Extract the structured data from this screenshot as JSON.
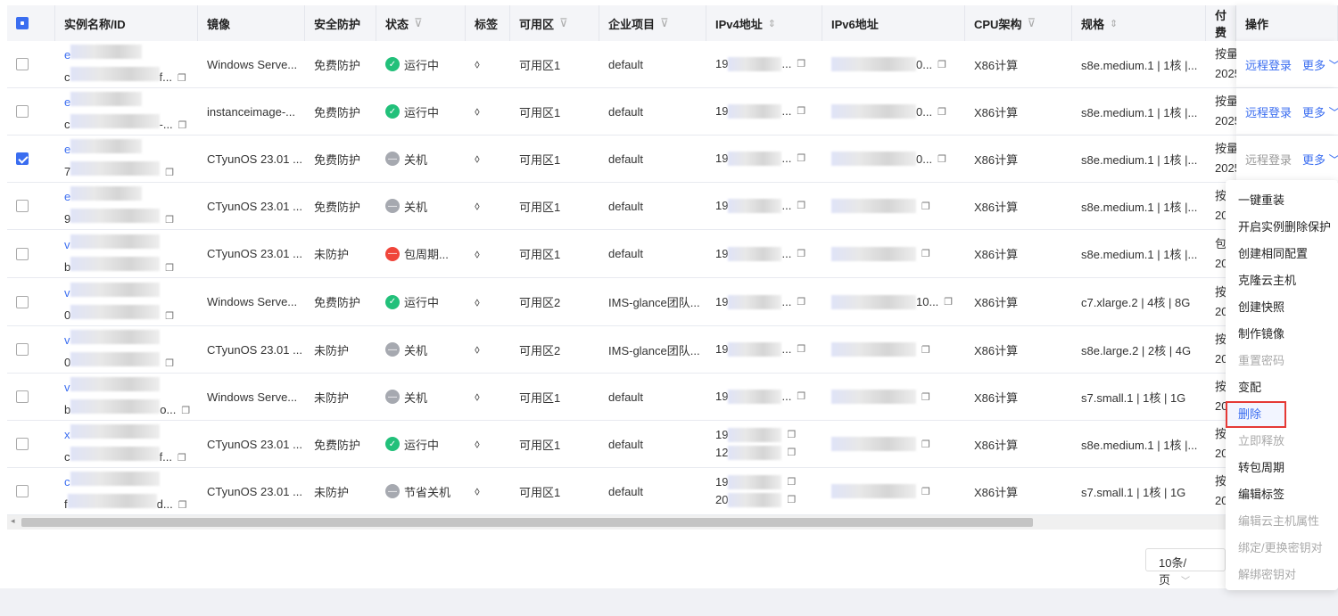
{
  "columns": [
    "实例名称/ID",
    "镜像",
    "安全防护",
    "状态",
    "标签",
    "可用区",
    "企业项目",
    "IPv4地址",
    "IPv6地址",
    "CPU架构",
    "规格",
    "付费",
    "操作"
  ],
  "rows": [
    {
      "checked": false,
      "name": "e",
      "id": "c",
      "idtail": "f...",
      "image": "Windows Serve...",
      "security": "免费防护",
      "status": "运行中",
      "st": "run",
      "zone": "可用区1",
      "project": "default",
      "ipv4": [
        "19"
      ],
      "ipv6": "0...",
      "cpu": "X86计算",
      "spec": "s8e.medium.1 | 1核 |...",
      "pay": [
        "按量",
        "2025"
      ],
      "login_disabled": false
    },
    {
      "checked": false,
      "name": "e",
      "id": "c",
      "idtail": "-...",
      "image": "instanceimage-...",
      "security": "免费防护",
      "status": "运行中",
      "st": "run",
      "zone": "可用区1",
      "project": "default",
      "ipv4": [
        "19"
      ],
      "ipv6": "0...",
      "cpu": "X86计算",
      "spec": "s8e.medium.1 | 1核 |...",
      "pay": [
        "按量",
        "2025"
      ],
      "login_disabled": false
    },
    {
      "checked": true,
      "name": "e",
      "id": "7",
      "idtail": "",
      "image": "CTyunOS 23.01 ...",
      "security": "免费防护",
      "status": "关机",
      "st": "off",
      "zone": "可用区1",
      "project": "default",
      "ipv4": [
        "19"
      ],
      "ipv6": "0...",
      "cpu": "X86计算",
      "spec": "s8e.medium.1 | 1核 |...",
      "pay": [
        "按量",
        "2025"
      ],
      "login_disabled": true
    },
    {
      "checked": false,
      "name": "e",
      "id": "9",
      "idtail": "",
      "image": "CTyunOS 23.01 ...",
      "security": "免费防护",
      "status": "关机",
      "st": "off",
      "zone": "可用区1",
      "project": "default",
      "ipv4": [
        "19"
      ],
      "ipv6": "",
      "cpu": "X86计算",
      "spec": "s8e.medium.1 | 1核 |...",
      "pay": [
        "按",
        "20"
      ]
    },
    {
      "checked": false,
      "name": "v",
      "id": "b",
      "idtail": "",
      "image": "CTyunOS 23.01 ...",
      "security": "未防护",
      "status": "包周期...",
      "st": "err",
      "zone": "可用区1",
      "project": "default",
      "ipv4": [
        "19"
      ],
      "ipv6": "",
      "cpu": "X86计算",
      "spec": "s8e.medium.1 | 1核 |...",
      "pay": [
        "包",
        "20"
      ]
    },
    {
      "checked": false,
      "name": "v",
      "id": "0",
      "idtail": "",
      "image": "Windows Serve...",
      "security": "免费防护",
      "status": "运行中",
      "st": "run",
      "zone": "可用区2",
      "project": "IMS-glance团队...",
      "ipv4": [
        "19"
      ],
      "ipv6": "10...",
      "cpu": "X86计算",
      "spec": "c7.xlarge.2 | 4核 | 8G",
      "pay": [
        "按",
        "20"
      ]
    },
    {
      "checked": false,
      "name": "v",
      "id": "0",
      "idtail": "",
      "image": "CTyunOS 23.01 ...",
      "security": "未防护",
      "status": "关机",
      "st": "off",
      "zone": "可用区2",
      "project": "IMS-glance团队...",
      "ipv4": [
        "19"
      ],
      "ipv6": "",
      "cpu": "X86计算",
      "spec": "s8e.large.2 | 2核 | 4G",
      "pay": [
        "按",
        "20"
      ]
    },
    {
      "checked": false,
      "name": "v",
      "id": "b",
      "idtail": "o...",
      "image": "Windows Serve...",
      "security": "未防护",
      "status": "关机",
      "st": "off",
      "zone": "可用区1",
      "project": "default",
      "ipv4": [
        "19"
      ],
      "ipv6": "",
      "cpu": "X86计算",
      "spec": "s7.small.1 | 1核 | 1G",
      "pay": [
        "按",
        "20"
      ]
    },
    {
      "checked": false,
      "name": "x",
      "id": "c",
      "idtail": "f...",
      "image": "CTyunOS 23.01 ...",
      "security": "免费防护",
      "status": "运行中",
      "st": "run",
      "zone": "可用区1",
      "project": "default",
      "ipv4": [
        "19",
        "12"
      ],
      "ipv6": "",
      "cpu": "X86计算",
      "spec": "s8e.medium.1 | 1核 |...",
      "pay": [
        "按",
        "20"
      ]
    },
    {
      "checked": false,
      "name": "c",
      "id": "f",
      "idtail": "d...",
      "image": "CTyunOS 23.01 ...",
      "security": "未防护",
      "status": "节省关机",
      "st": "off",
      "zone": "可用区1",
      "project": "default",
      "ipv4": [
        "19",
        "20"
      ],
      "ipv6": "",
      "cpu": "X86计算",
      "spec": "s7.small.1 | 1核 | 1G",
      "pay": [
        "按",
        "20"
      ]
    }
  ],
  "ops": {
    "login": "远程登录",
    "more": "更多"
  },
  "menu": [
    {
      "label": "一键重装",
      "state": "normal"
    },
    {
      "label": "开启实例删除保护",
      "state": "normal"
    },
    {
      "label": "创建相同配置",
      "state": "normal"
    },
    {
      "label": "克隆云主机",
      "state": "normal"
    },
    {
      "label": "创建快照",
      "state": "normal"
    },
    {
      "label": "制作镜像",
      "state": "normal"
    },
    {
      "label": "重置密码",
      "state": "disabled"
    },
    {
      "label": "变配",
      "state": "normal"
    },
    {
      "label": "删除",
      "state": "active"
    },
    {
      "label": "立即释放",
      "state": "disabled"
    },
    {
      "label": "转包周期",
      "state": "normal"
    },
    {
      "label": "编辑标签",
      "state": "normal"
    },
    {
      "label": "编辑云主机属性",
      "state": "disabled"
    },
    {
      "label": "绑定/更换密钥对",
      "state": "disabled"
    },
    {
      "label": "解绑密钥对",
      "state": "disabled"
    }
  ],
  "pager": {
    "page_size": "10条/页"
  }
}
